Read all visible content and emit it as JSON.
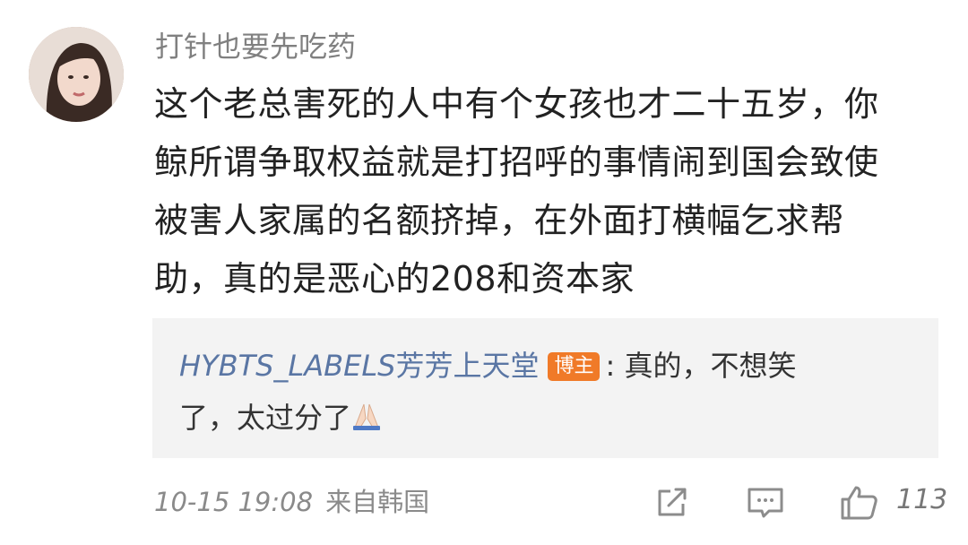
{
  "comment": {
    "username": "打针也要先吃药",
    "lines": [
      "这个老总害死的人中有个女孩也才二十五岁，你",
      "鲸所谓争取权益就是打招呼的事情闹到国会致使",
      "被害人家属的名额挤掉，在外面打横幅乞求帮",
      "助，真的是恶心的208和资本家"
    ]
  },
  "reply": {
    "user_latin": "HYBTS_LABELS",
    "user_cn": "芳芳上天堂",
    "badge": "博主",
    "text_line1": ": 真的，不想笑",
    "text_line2": "了，太过分了"
  },
  "footer": {
    "time": "10-15 19:08",
    "source": "来自韩国",
    "like_count": "113"
  }
}
